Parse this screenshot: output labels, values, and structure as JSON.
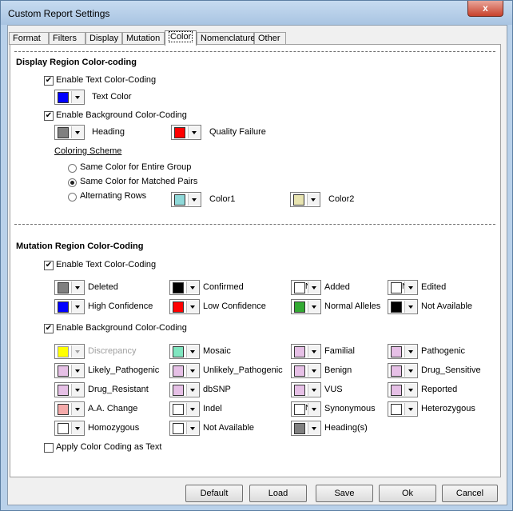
{
  "window": {
    "title": "Custom Report Settings",
    "close_glyph": "x"
  },
  "tabs": [
    {
      "label": "Format"
    },
    {
      "label": "Filters"
    },
    {
      "label": "Display"
    },
    {
      "label": "Mutation"
    },
    {
      "label": "Color",
      "active": true
    },
    {
      "label": "Nomenclature"
    },
    {
      "label": "Other"
    }
  ],
  "display_region": {
    "heading": "Display Region Color-coding",
    "enable_text": {
      "label": "Enable Text Color-Coding",
      "checked": true
    },
    "text_color": {
      "label": "Text Color",
      "color": "#0000ff"
    },
    "enable_background": {
      "label": "Enable Background Color-Coding",
      "checked": true
    },
    "heading_color": {
      "label": "Heading",
      "color": "#808080"
    },
    "quality_failure": {
      "label": "Quality Failure",
      "color": "#ff0000"
    },
    "coloring_scheme": {
      "label": "Coloring Scheme",
      "options": [
        {
          "label": "Same Color for Entire Group",
          "selected": false
        },
        {
          "label": "Same Color for Matched Pairs",
          "selected": true
        },
        {
          "label": "Alternating Rows",
          "selected": false
        }
      ]
    },
    "color1": {
      "label": "Color1",
      "color": "#8fd9d9"
    },
    "color2": {
      "label": "Color2",
      "color": "#e8e4b0"
    }
  },
  "mutation_region": {
    "heading": "Mutation Region Color-Coding",
    "enable_text": {
      "label": "Enable Text Color-Coding",
      "checked": true
    },
    "text_items": [
      {
        "label": "Deleted",
        "color": "#808080"
      },
      {
        "label": "Confirmed",
        "color": "#000000"
      },
      {
        "label": "Added",
        "color": "#ffffff",
        "text": "N"
      },
      {
        "label": "Edited",
        "color": "#ffffff",
        "text": "N"
      },
      {
        "label": "High Confidence",
        "color": "#0000ff"
      },
      {
        "label": "Low Confidence",
        "color": "#ff0000"
      },
      {
        "label": "Normal Alleles",
        "color": "#33aa33"
      },
      {
        "label": "Not Available",
        "color": "#000000"
      }
    ],
    "enable_background": {
      "label": "Enable Background Color-Coding",
      "checked": true
    },
    "bg_items": [
      {
        "label": "Discrepancy",
        "color": "#ffff00",
        "disabled": true
      },
      {
        "label": "Mosaic",
        "color": "#80e6c0"
      },
      {
        "label": "Familial",
        "color": "#e6c0e6"
      },
      {
        "label": "Pathogenic",
        "color": "#e6c0e6"
      },
      {
        "label": "Likely_Pathogenic",
        "color": "#e6c0e6"
      },
      {
        "label": "Unlikely_Pathogenic",
        "color": "#e6c0e6"
      },
      {
        "label": "Benign",
        "color": "#e6c0e6"
      },
      {
        "label": "Drug_Sensitive",
        "color": "#e6c0e6"
      },
      {
        "label": "Drug_Resistant",
        "color": "#e6c0e6"
      },
      {
        "label": "dbSNP",
        "color": "#e6c0e6"
      },
      {
        "label": "VUS",
        "color": "#e6c0e6"
      },
      {
        "label": "Reported",
        "color": "#e6c0e6"
      },
      {
        "label": "A.A. Change",
        "color": "#f5aaaa"
      },
      {
        "label": "Indel",
        "color": "#ffffff"
      },
      {
        "label": "Synonymous",
        "color": "#ffffff",
        "text": "N"
      },
      {
        "label": "Heterozygous",
        "color": "#ffffff"
      },
      {
        "label": "Homozygous",
        "color": "#ffffff"
      },
      {
        "label": "Not Available",
        "color": "#ffffff"
      },
      {
        "label": "Heading(s)",
        "color": "#808080"
      }
    ],
    "apply_as_text": {
      "label": "Apply Color Coding as Text",
      "checked": false
    }
  },
  "buttons": {
    "default": "Default",
    "load": "Load",
    "save": "Save",
    "ok": "Ok",
    "cancel": "Cancel"
  },
  "glyphs": {
    "check": "✔"
  }
}
